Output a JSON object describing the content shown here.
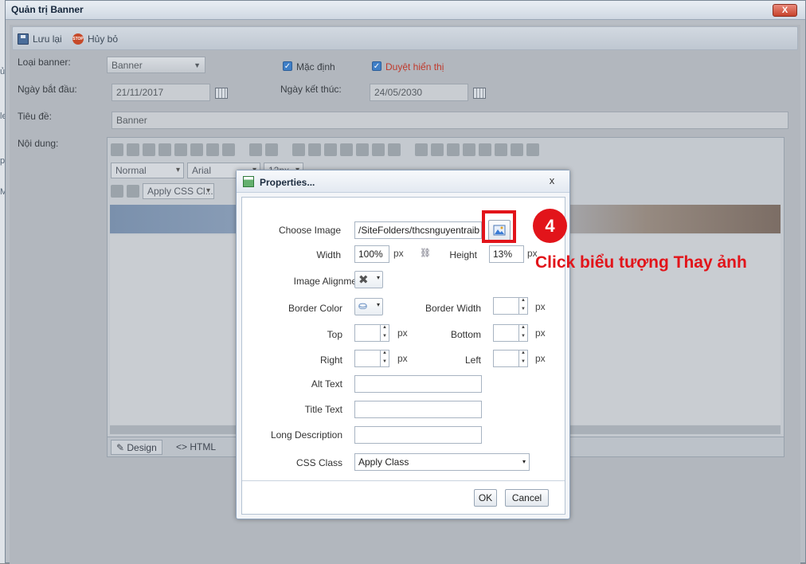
{
  "window": {
    "title": "Quản trị Banner",
    "close_glyph": "X"
  },
  "background": {
    "edge_text": [
      "ủ",
      "le",
      "p",
      "M"
    ]
  },
  "toolbar": {
    "save_label": "Lưu lại",
    "cancel_label": "Hủy bỏ",
    "stop_icon_text": "STOP"
  },
  "form": {
    "type_label": "Loại banner:",
    "type_value": "Banner",
    "default_checkbox_label": "Mặc định",
    "approved_checkbox_label": "Duyệt hiển thị",
    "start_label": "Ngày bắt đầu:",
    "start_value": "21/11/2017",
    "end_label": "Ngày kết thúc:",
    "end_value": "24/05/2030",
    "title_label": "Tiêu đề:",
    "title_value": "Banner",
    "content_label": "Nội dung:"
  },
  "editor": {
    "paragraph_combo": "Normal",
    "font_combo": "Arial",
    "size_combo": "12px",
    "css_combo": "Apply CSS Cl...",
    "mode_design": "Design",
    "mode_html": "HTML"
  },
  "dialog": {
    "title": "Properties...",
    "close_glyph": "x",
    "choose_image_label": "Choose Image",
    "choose_image_value": "/SiteFolders/thcsnguyentraib",
    "width_label": "Width",
    "width_value": "100%",
    "height_label": "Height",
    "height_value": "13%",
    "unit_px": "px",
    "image_alignment_label": "Image Alignment",
    "border_color_label": "Border Color",
    "border_width_label": "Border Width",
    "top_label": "Top",
    "bottom_label": "Bottom",
    "right_label": "Right",
    "left_label": "Left",
    "alt_text_label": "Alt Text",
    "title_text_label": "Title Text",
    "long_description_label": "Long Description",
    "css_class_label": "CSS Class",
    "css_class_value": "Apply Class",
    "ok_label": "OK",
    "cancel_label": "Cancel"
  },
  "annotation": {
    "step_number": "4",
    "instruction": "Click biểu tượng Thay ảnh",
    "color": "#e2141a"
  }
}
